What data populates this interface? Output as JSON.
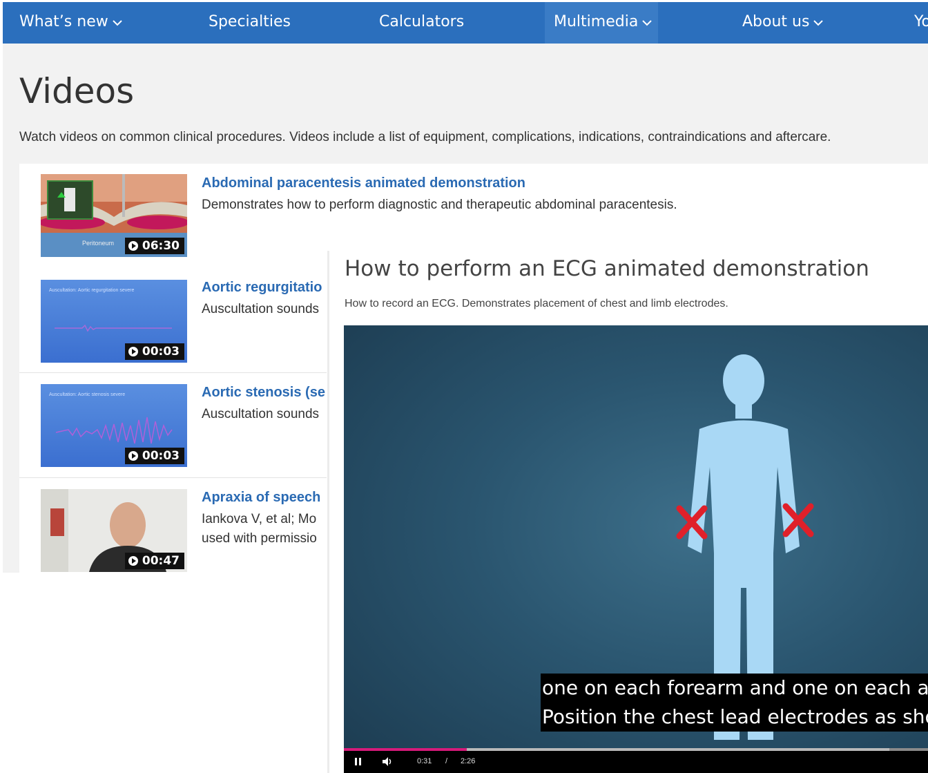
{
  "nav": {
    "items": [
      {
        "label": "What’s new",
        "has_dropdown": true
      },
      {
        "label": "Specialties",
        "has_dropdown": false
      },
      {
        "label": "Calculators",
        "has_dropdown": false
      },
      {
        "label": "Multimedia",
        "has_dropdown": true,
        "active": true
      },
      {
        "label": "About us",
        "has_dropdown": true
      },
      {
        "label": "Yo",
        "has_dropdown": false
      }
    ],
    "cursor_label": "I"
  },
  "page": {
    "title": "Videos",
    "description": "Watch videos on common clinical procedures. Videos include a list of equipment, complications, indications, contraindications and aftercare."
  },
  "videos": [
    {
      "title": "Abdominal paracentesis animated demonstration",
      "description": "Demonstrates how to perform diagnostic and therapeutic abdominal paracentesis.",
      "duration": "06:30",
      "thumb_label": "Peritoneum"
    },
    {
      "title": "Aortic regurgitatio",
      "description": "Auscultation sounds",
      "duration": "00:03",
      "thumb_label": "Auscultation: Aortic regurgitation severe"
    },
    {
      "title": "Aortic stenosis (se",
      "description": "Auscultation sounds",
      "duration": "00:03",
      "thumb_label": "Auscultation: Aortic stenosis severe"
    },
    {
      "title": "Apraxia of speech",
      "description_line1": "Iankova V, et al; Mo",
      "description_line2": "used with permissio",
      "duration": "00:47"
    }
  ],
  "overlay": {
    "title": "How to perform an ECG animated demonstration",
    "description": "How to record an ECG. Demonstrates placement of chest and limb electrodes.",
    "caption_line1": "one on each forearm and one on each ankl",
    "caption_line2": "Position the chest lead electrodes as show",
    "current_time": "0:31",
    "separator": "/",
    "total_time": "2:26",
    "progress_fraction": 0.21,
    "buffered_fraction": 0.93
  },
  "colors": {
    "nav_bg": "#2b6fbd",
    "link": "#2a6ab3",
    "progress": "#d61a7a",
    "marker": "#e0202a",
    "figure": "#a9d8f5"
  },
  "icons": [
    "chevron-down-icon",
    "play-icon",
    "pause-icon",
    "volume-icon"
  ]
}
